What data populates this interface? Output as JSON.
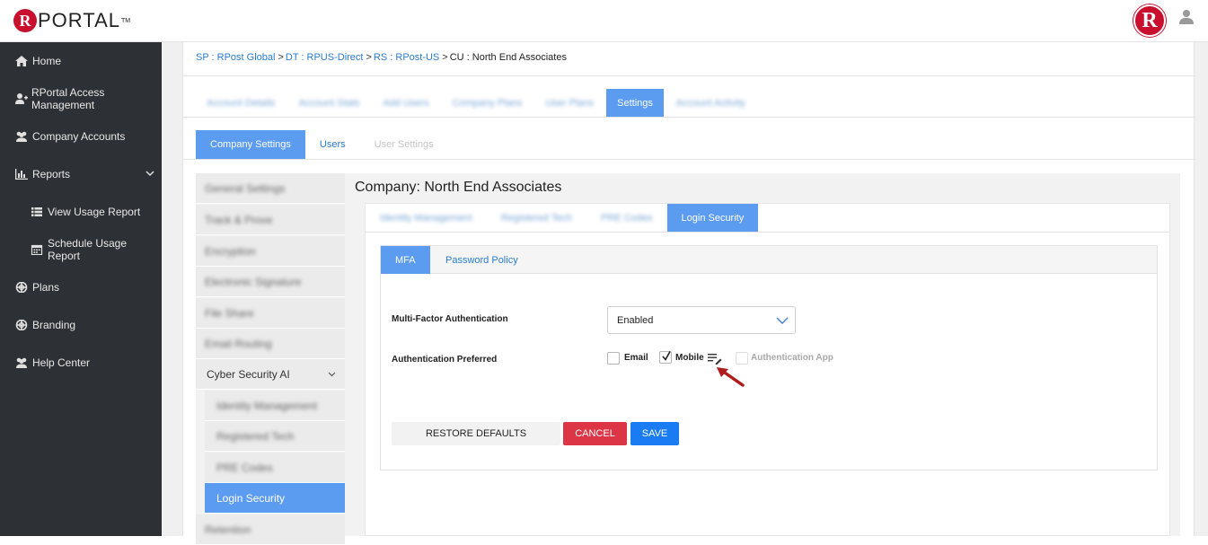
{
  "brand": {
    "logo_letter": "R",
    "logo_text": "PORTAL",
    "logo_tm": "TM",
    "avatar_letter": "R"
  },
  "sidebar": {
    "items": [
      {
        "label": "Home",
        "icon": "home-icon"
      },
      {
        "label": "RPortal Access Management",
        "icon": "user-plus-icon"
      },
      {
        "label": "Company Accounts",
        "icon": "users-icon"
      },
      {
        "label": "Reports",
        "icon": "bar-chart-icon"
      },
      {
        "label": "View Usage Report",
        "icon": "list-icon"
      },
      {
        "label": "Schedule Usage Report",
        "icon": "calendar-icon"
      },
      {
        "label": "Plans",
        "icon": "lifebuoy-icon"
      },
      {
        "label": "Branding",
        "icon": "lifebuoy-icon"
      },
      {
        "label": "Help Center",
        "icon": "users-icon"
      }
    ]
  },
  "breadcrumb": {
    "sp": "SP : RPost Global",
    "dt": "DT : RPUS-Direct",
    "rs": "RS : RPost-US",
    "cu": "CU : North End Associates",
    "sep": ">"
  },
  "account_tabs": {
    "items": [
      "Account Details",
      "Account Stats",
      "Add Users",
      "Company Plans",
      "User Plans",
      "Settings",
      "Account Activity"
    ],
    "active": "Settings"
  },
  "company_tabs": {
    "items": [
      "Company Settings",
      "Users",
      "User Settings"
    ]
  },
  "settings_nav": {
    "items": [
      "General Settings",
      "Track & Prove",
      "Encryption",
      "Electronic Signature",
      "File Share",
      "Email Routing",
      "Cyber Security AI",
      "Identity Management",
      "Registered Tech",
      "PRE Codes",
      "Login Security",
      "Retention"
    ]
  },
  "company_title": "Company: North End Associates",
  "security_tabs": {
    "items": [
      "Identity Management",
      "Registered Tech",
      "PRE Codes",
      "Login Security"
    ]
  },
  "mfa_tabs": {
    "items": [
      "MFA",
      "Password Policy"
    ]
  },
  "form": {
    "mfa_label": "Multi-Factor Authentication",
    "mfa_value": "Enabled",
    "preferred_label": "Authentication Preferred",
    "options": [
      {
        "label": "Email",
        "checked": false,
        "disabled": false
      },
      {
        "label": "Mobile",
        "checked": true,
        "disabled": false
      },
      {
        "label": "Authentication App",
        "checked": false,
        "disabled": true
      }
    ]
  },
  "buttons": {
    "restore": "RESTORE DEFAULTS",
    "cancel": "CANCEL",
    "save": "SAVE"
  },
  "colors": {
    "accent": "#5b9bf0",
    "sidebar_bg": "#2d3035",
    "brand_red": "#c8102e",
    "cancel": "#dc3545",
    "save": "#1a7cf2",
    "link": "#2a7ccf"
  }
}
